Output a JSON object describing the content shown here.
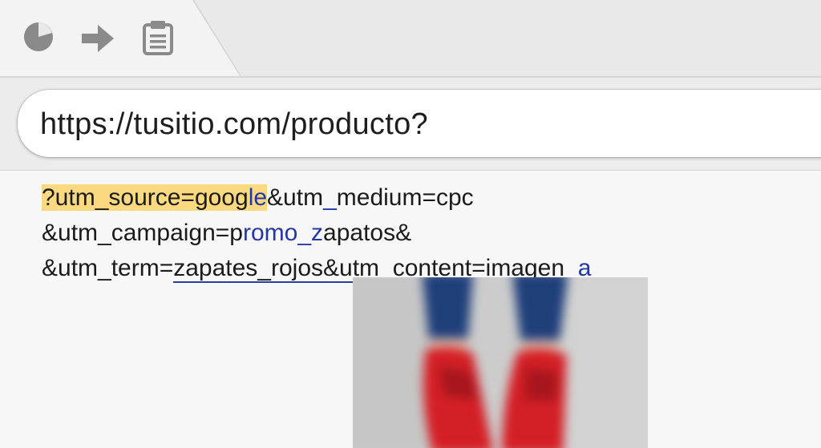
{
  "browser": {
    "nav_icons": [
      "history-icon",
      "forward-arrow-icon",
      "clipboard-icon"
    ],
    "address_bar": {
      "url": "https://tusitio.com/producto?"
    }
  },
  "utm_params": {
    "line1": {
      "part1": "?utm_source=goog",
      "part2": "le",
      "part3": "&utm",
      "part4": "_",
      "part5": "medium=cpc"
    },
    "line2": {
      "part1": "&utm_campaign=p",
      "part2": "romo_z",
      "part3": "apatos&"
    },
    "line3": {
      "part1": "&utm_term=",
      "part2": "zapates_rojos&utm_content=imagen",
      "part3": "_a"
    }
  },
  "colors": {
    "highlight": "#fbd981",
    "link_blue": "#2238a8",
    "shoes_red": "#d41f26",
    "jeans_blue": "#1f3f7a"
  }
}
